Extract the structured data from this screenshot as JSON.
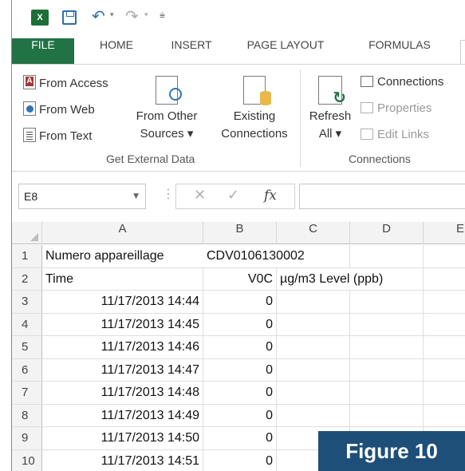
{
  "qat": {
    "app_icon": "excel-icon",
    "save_icon": "save-icon",
    "undo_icon": "undo-icon",
    "redo_icon": "redo-icon",
    "customize_icon": "customize-qat-icon"
  },
  "tabs": {
    "file": "FILE",
    "home": "HOME",
    "insert": "INSERT",
    "page_layout": "PAGE LAYOUT",
    "formulas": "FORMULAS"
  },
  "ribbon": {
    "get_external_data": {
      "from_access": "From Access",
      "from_web": "From Web",
      "from_text": "From Text",
      "from_other_line1": "From Other",
      "from_other_line2": "Sources ▾",
      "existing_line1": "Existing",
      "existing_line2": "Connections",
      "label": "Get External Data"
    },
    "connections": {
      "refresh_line1": "Refresh",
      "refresh_line2": "All ▾",
      "connections": "Connections",
      "properties": "Properties",
      "edit_links": "Edit Links",
      "label": "Connections"
    }
  },
  "formula_bar": {
    "name_box": "E8",
    "cancel_symbol": "✕",
    "enter_symbol": "✓",
    "fx": "fx",
    "value": ""
  },
  "grid": {
    "columns": [
      "A",
      "B",
      "C",
      "D",
      "E"
    ],
    "rows": [
      {
        "num": "1",
        "a": "Numero appareillage",
        "b": "CDV0106130002",
        "c": ""
      },
      {
        "num": "2",
        "a": "Time",
        "b": "V0C",
        "c": "µg/m3 Level (ppb)"
      },
      {
        "num": "3",
        "a": "11/17/2013 14:44",
        "b": "0",
        "c": ""
      },
      {
        "num": "4",
        "a": "11/17/2013 14:45",
        "b": "0",
        "c": ""
      },
      {
        "num": "5",
        "a": "11/17/2013 14:46",
        "b": "0",
        "c": ""
      },
      {
        "num": "6",
        "a": "11/17/2013 14:47",
        "b": "0",
        "c": ""
      },
      {
        "num": "7",
        "a": "11/17/2013 14:48",
        "b": "0",
        "c": ""
      },
      {
        "num": "8",
        "a": "11/17/2013 14:49",
        "b": "0",
        "c": ""
      },
      {
        "num": "9",
        "a": "11/17/2013 14:50",
        "b": "0",
        "c": ""
      },
      {
        "num": "10",
        "a": "11/17/2013 14:51",
        "b": "0",
        "c": ""
      }
    ]
  },
  "figure_label": "Figure 10"
}
